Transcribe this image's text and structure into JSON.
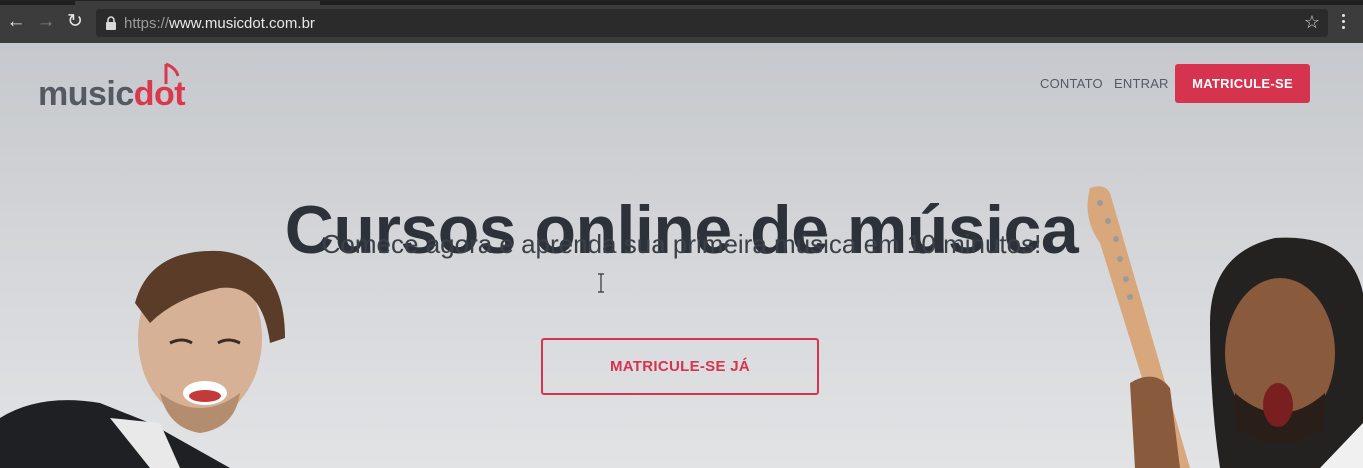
{
  "browser": {
    "url_scheme": "https://",
    "url_host": "www.musicdot.com.br",
    "back_icon": "arrow-left",
    "forward_icon": "arrow-right",
    "reload_icon": "reload",
    "star_icon": "star",
    "menu_icon": "vertical-dots"
  },
  "site": {
    "logo_main": "music",
    "logo_accent": "dot",
    "nav": {
      "contact": "CONTATO",
      "login": "ENTRAR",
      "signup": "MATRICULE-SE"
    },
    "hero": {
      "title": "Cursos online de música",
      "subtitle": "Comece agora e aprenda sua primeira música em 10 minutos!",
      "cta": "MATRICULE-SE JÁ"
    }
  },
  "colors": {
    "brand": "#d6344e",
    "text_dark": "#2d323a",
    "logo_gray": "#555a62"
  }
}
